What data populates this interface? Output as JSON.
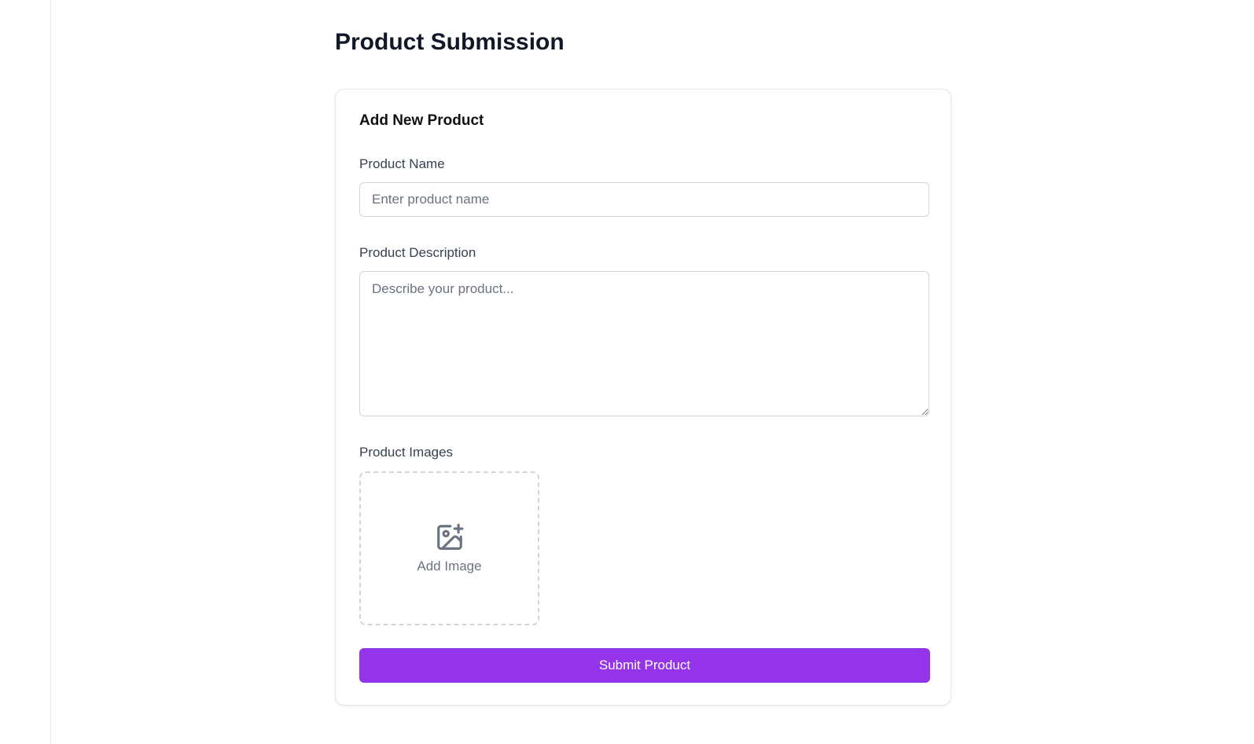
{
  "page": {
    "title": "Product Submission"
  },
  "form": {
    "title": "Add New Product",
    "name": {
      "label": "Product Name",
      "value": "",
      "placeholder": "Enter product name"
    },
    "description": {
      "label": "Product Description",
      "value": "",
      "placeholder": "Describe your product..."
    },
    "images": {
      "label": "Product Images",
      "add_label": "Add Image",
      "icon": "image-plus-icon"
    },
    "submit_label": "Submit Product"
  },
  "colors": {
    "accent": "#9333ea",
    "border": "#d1d5db",
    "muted_text": "#6b7280"
  }
}
